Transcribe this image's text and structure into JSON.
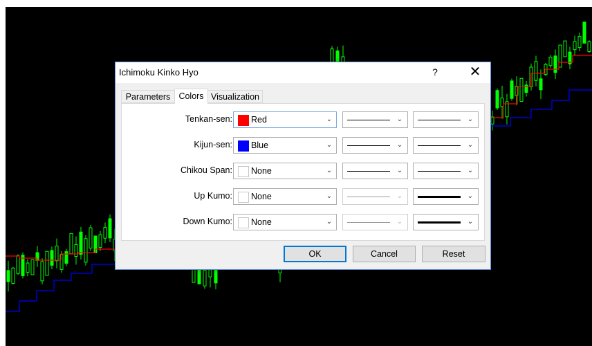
{
  "dialog": {
    "title": "Ichimoku Kinko Hyo",
    "help_glyph": "?",
    "close_glyph": "✕"
  },
  "tabs": [
    {
      "label": "Parameters",
      "active": false
    },
    {
      "label": "Colors",
      "active": true
    },
    {
      "label": "Visualization",
      "active": false
    }
  ],
  "rows": [
    {
      "label": "Tenkan-sen:",
      "color_name": "Red",
      "swatch": "#ff0000",
      "style_enabled": true,
      "width": "thin"
    },
    {
      "label": "Kijun-sen:",
      "color_name": "Blue",
      "swatch": "#0000ff",
      "style_enabled": true,
      "width": "thin"
    },
    {
      "label": "Chikou Span:",
      "color_name": "None",
      "swatch": "#ffffff",
      "style_enabled": true,
      "width": "thin"
    },
    {
      "label": "Up Kumo:",
      "color_name": "None",
      "swatch": "#ffffff",
      "style_enabled": false,
      "width": "thick"
    },
    {
      "label": "Down Kumo:",
      "color_name": "None",
      "swatch": "#ffffff",
      "style_enabled": false,
      "width": "thick"
    }
  ],
  "buttons": {
    "ok": "OK",
    "cancel": "Cancel",
    "reset": "Reset"
  },
  "colors": {
    "chart_background": "#000000",
    "candle": "#00ff00",
    "tenkan_line": "#ff0000",
    "kijun_line": "#0000ff",
    "dialog_border": "#5b8bd9",
    "default_button_border": "#0078d7"
  },
  "icons": {
    "dropdown": "chevron-down-icon"
  }
}
